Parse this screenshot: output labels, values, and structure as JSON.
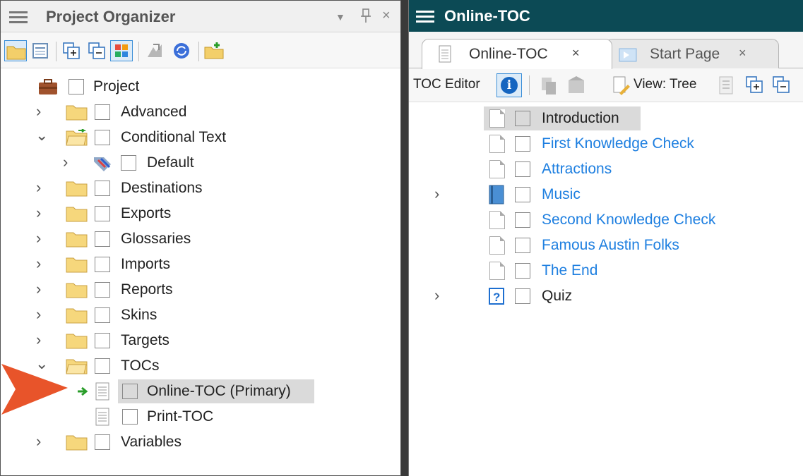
{
  "left_panel": {
    "title": "Project Organizer",
    "controls": {
      "dropdown": "▼",
      "pin": "И",
      "close": "×"
    },
    "toolbar_icons": [
      "open-folder-icon",
      "properties-icon",
      "expand-all-icon",
      "collapse-all-icon",
      "color-toggle-icon",
      "import-icon",
      "refresh-icon",
      "new-folder-icon"
    ],
    "tree": {
      "root": "Project",
      "items": [
        {
          "label": "Advanced",
          "expanded": false
        },
        {
          "label": "Conditional Text",
          "expanded": true
        },
        {
          "label": "Default"
        },
        {
          "label": "Destinations",
          "expanded": false
        },
        {
          "label": "Exports",
          "expanded": false
        },
        {
          "label": "Glossaries",
          "expanded": false
        },
        {
          "label": "Imports",
          "expanded": false
        },
        {
          "label": "Reports",
          "expanded": false
        },
        {
          "label": "Skins",
          "expanded": false
        },
        {
          "label": "Targets",
          "expanded": false
        },
        {
          "label": "TOCs",
          "expanded": true
        },
        {
          "label": "Online-TOC (Primary)",
          "selected": true
        },
        {
          "label": "Print-TOC"
        },
        {
          "label": "Variables",
          "expanded": false
        }
      ]
    }
  },
  "right_panel": {
    "title": "Online-TOC",
    "tabs": [
      {
        "label": "Online-TOC",
        "close": "×",
        "active": true
      },
      {
        "label": "Start Page",
        "close": "×",
        "active": false
      }
    ],
    "toolbar": {
      "editor_label": "TOC Editor",
      "view_label": "View: Tree"
    },
    "toc_items": [
      {
        "label": "Introduction",
        "style": "selected"
      },
      {
        "label": "First Knowledge Check",
        "style": "link"
      },
      {
        "label": "Attractions",
        "style": "link"
      },
      {
        "label": "Music",
        "style": "link",
        "icon": "book-icon",
        "expandable": true
      },
      {
        "label": "Second Knowledge Check",
        "style": "link"
      },
      {
        "label": "Famous Austin Folks",
        "style": "link"
      },
      {
        "label": "The End",
        "style": "link"
      },
      {
        "label": "Quiz",
        "style": "plain",
        "icon": "quiz-icon",
        "expandable": true
      }
    ]
  },
  "colors": {
    "right_title_bar": "#0c4a55",
    "link": "#1e7fe0",
    "pointer_arrow": "#e8542a",
    "selection": "#dadada",
    "active_button": "#3c8fd8"
  }
}
